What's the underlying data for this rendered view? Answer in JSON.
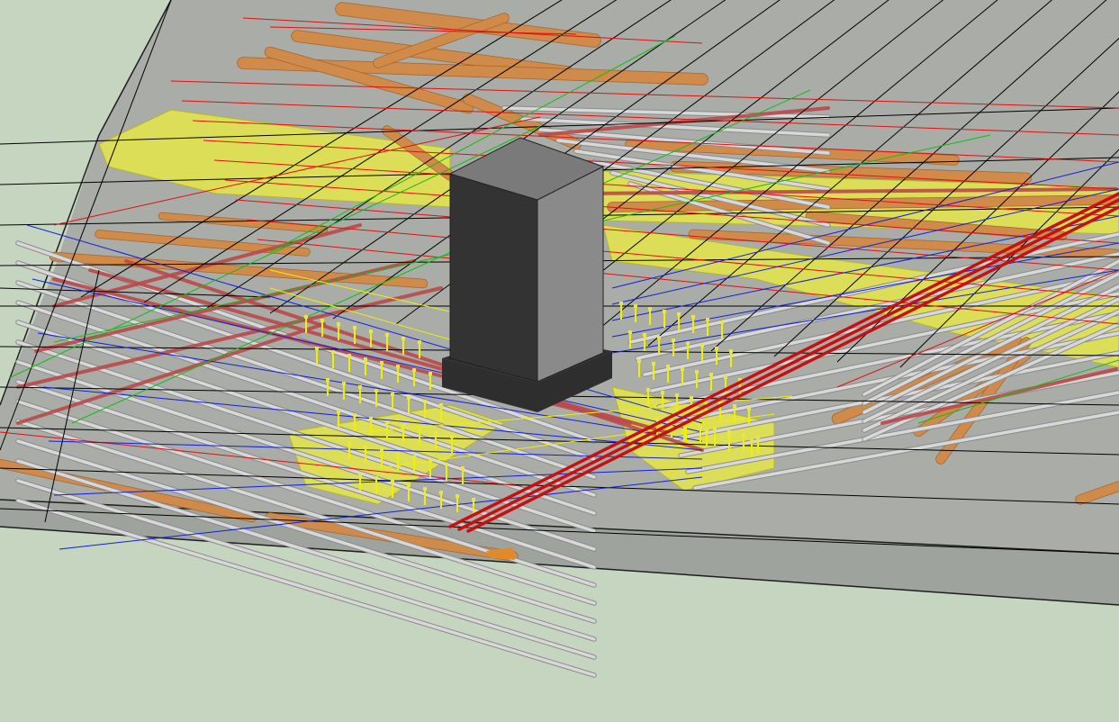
{
  "viewport": {
    "background_color": "#c5d5c0",
    "slab_top_color": "#a9aca7",
    "slab_edge_color": "#9fa39d",
    "slab_outline_color": "#1e1e1e"
  },
  "colors": {
    "column_front": "#333333",
    "column_side": "#8a8a8a",
    "column_top": "#7a7a7a",
    "column_base": "#2e2e2e",
    "timber": "#d08a4a",
    "timber_dark": "#a5642c",
    "steel_bar": "#d8d8d8",
    "steel_bar_dark": "#8c8c8c",
    "red_bar": "#b84a4a",
    "red_line": "#e01010",
    "blue_line": "#1020d8",
    "green_line": "#10c010",
    "black_line": "#000000",
    "yellow_panel": "#e6e64a",
    "yellow_panel_edge": "#b6b62a",
    "yellow_line": "#f0f000"
  },
  "objects": {
    "column": "concrete-column",
    "slab": "floor-slab",
    "panels": "formwork-panels",
    "timbers": "timber-props",
    "rebars": "rebar-bars",
    "chairs": "rebar-chairs",
    "analysis_lines": "analysis-lines"
  }
}
